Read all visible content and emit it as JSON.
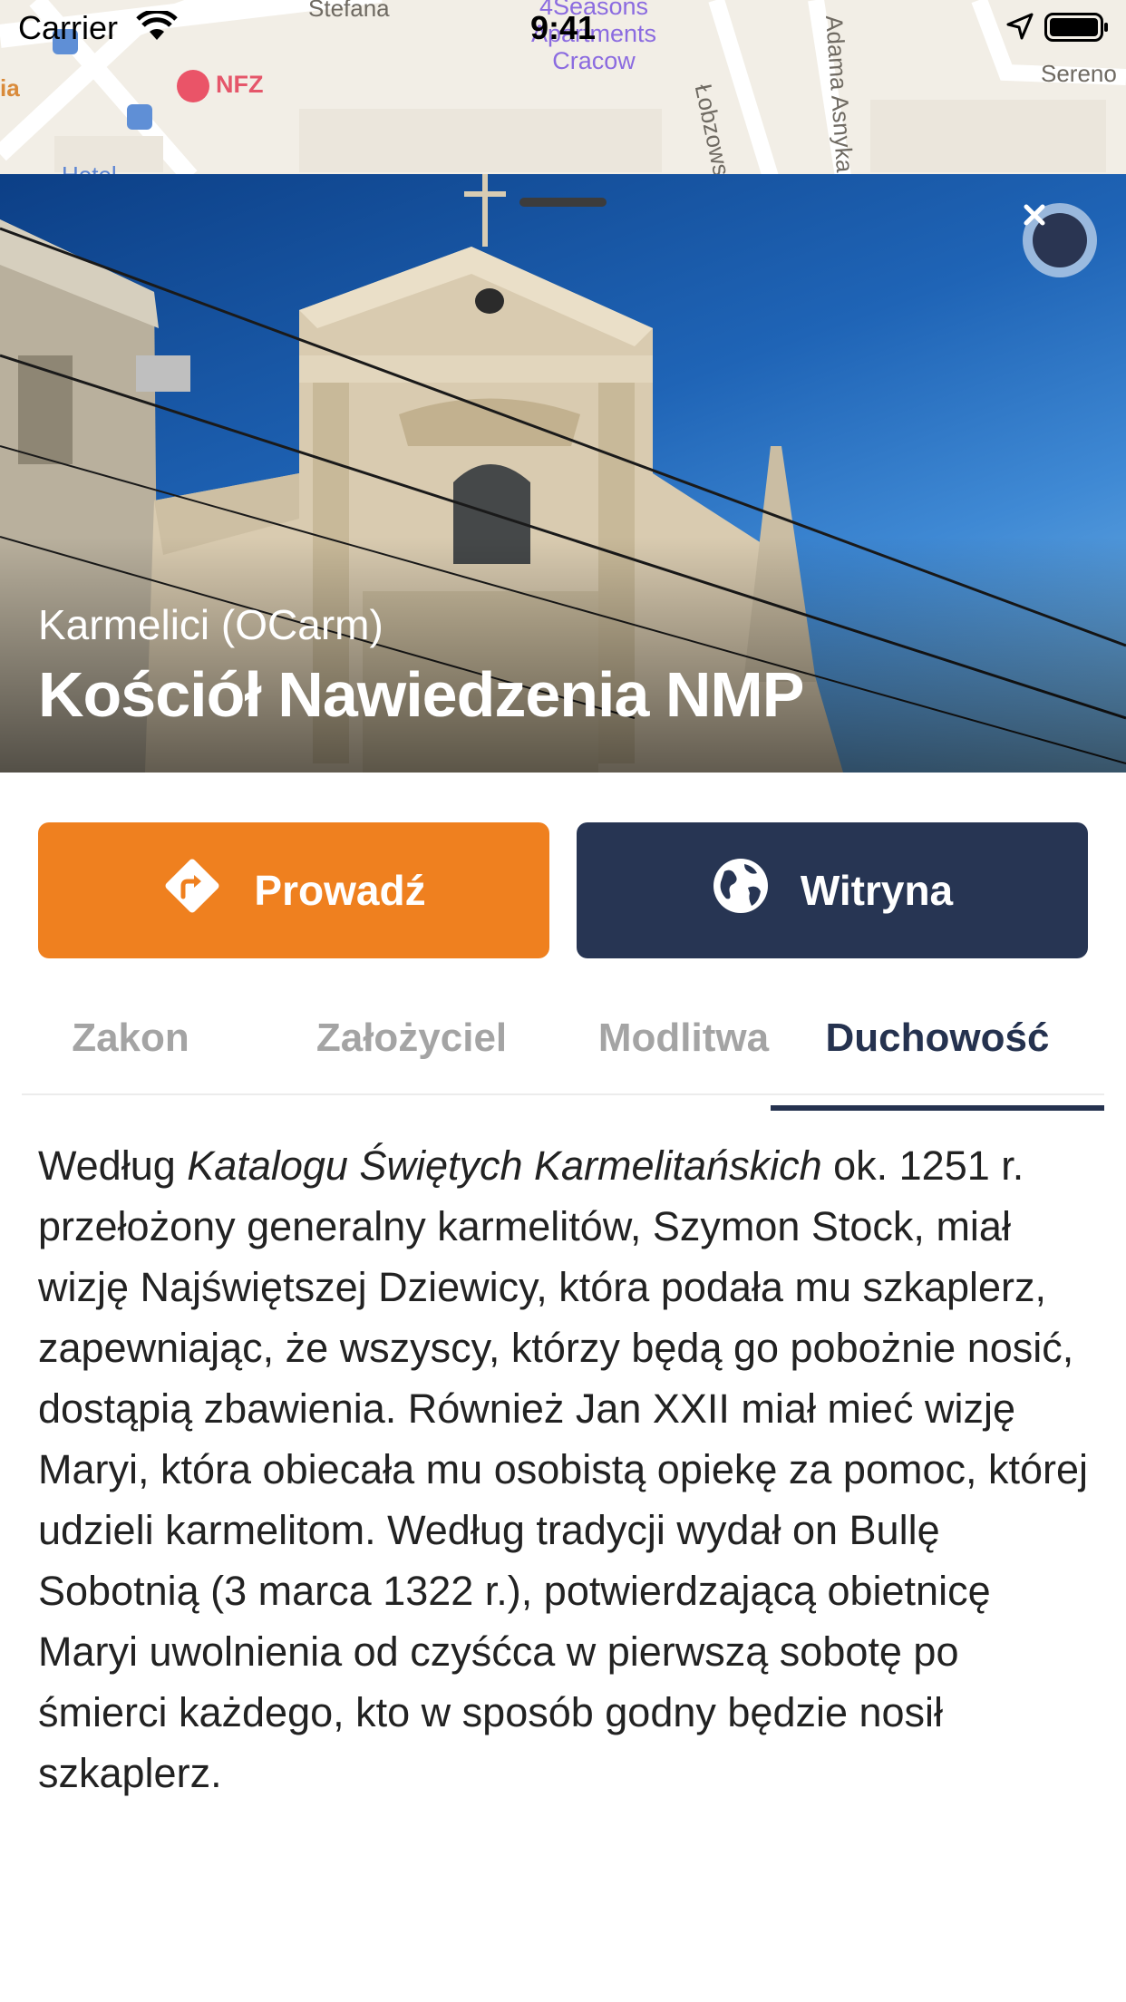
{
  "status_bar": {
    "carrier": "Carrier",
    "time": "9:41"
  },
  "map": {
    "street_1": "Stefana",
    "street_2": "Łobzowska",
    "street_3": "Adama Asnyka",
    "street_4": "Sereno",
    "street_5": "Hotel",
    "place_apartments": "4Seasons Apartments Cracow",
    "place_nfz": "NFZ",
    "edge_label": "ia"
  },
  "place": {
    "subtitle": "Karmelici (OCarm)",
    "title": "Kościół Nawiedzenia NMP"
  },
  "actions": {
    "navigate_label": "Prowadź",
    "website_label": "Witryna",
    "navigate_color": "#ef801f",
    "website_color": "#273553"
  },
  "tabs": [
    "Zakon",
    "Założyciel",
    "Modlitwa",
    "Duchowość"
  ],
  "active_tab": "Duchowość",
  "content": {
    "p1_intro": "Według ",
    "p1_italic": "Katalogu Świętych Karmelitańskich",
    "p1_rest": " ok. 1251 r. przełożony generalny karmelitów, Szymon Stock, miał wizję Najświętszej Dziewicy, która podała mu szkaplerz, zapewniając, że wszyscy, którzy będą go pobożnie nosić, dostąpią zbawienia. Również Jan XXII miał mieć wizję Maryi, która obiecała mu osobistą opiekę za pomoc, której udzieli karmelitom. Według tradycji wydał on Bullę Sobotnią (3 marca 1322 r.), potwierdzającą obietnicę Maryi uwolnienia od czyśćca w pierwszą sobotę po śmierci każdego, kto w sposób godny będzie nosił szkaplerz."
  },
  "icons": {
    "close": "close-icon",
    "navigate": "directions-icon",
    "website": "globe-icon"
  }
}
